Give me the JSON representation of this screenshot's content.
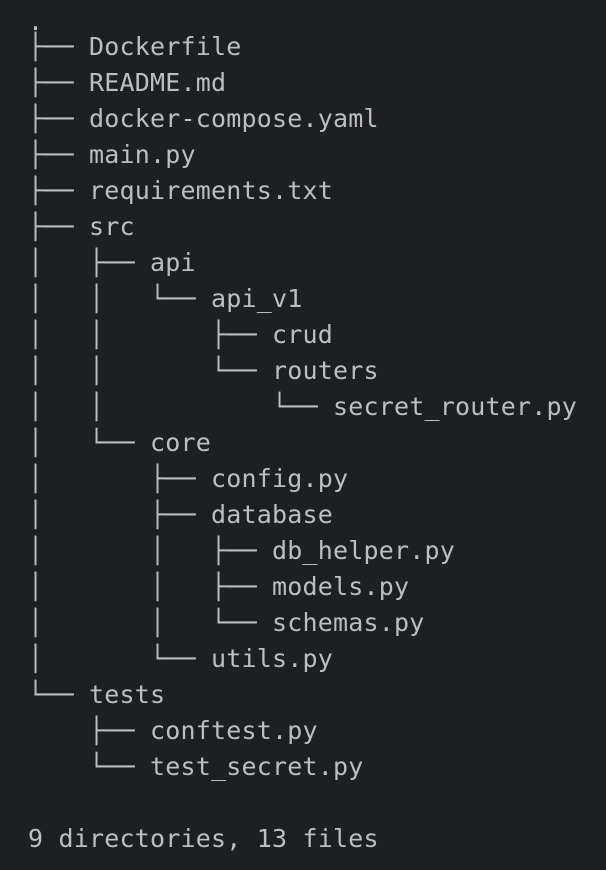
{
  "tree": {
    "root": ".",
    "lines": [
      {
        "prefix": "├── ",
        "name": "Dockerfile"
      },
      {
        "prefix": "├── ",
        "name": "README.md"
      },
      {
        "prefix": "├── ",
        "name": "docker-compose.yaml"
      },
      {
        "prefix": "├── ",
        "name": "main.py"
      },
      {
        "prefix": "├── ",
        "name": "requirements.txt"
      },
      {
        "prefix": "├── ",
        "name": "src"
      },
      {
        "prefix": "│   ├── ",
        "name": "api"
      },
      {
        "prefix": "│   │   └── ",
        "name": "api_v1"
      },
      {
        "prefix": "│   │       ├── ",
        "name": "crud"
      },
      {
        "prefix": "│   │       └── ",
        "name": "routers"
      },
      {
        "prefix": "│   │           └── ",
        "name": "secret_router.py"
      },
      {
        "prefix": "│   └── ",
        "name": "core"
      },
      {
        "prefix": "│       ├── ",
        "name": "config.py"
      },
      {
        "prefix": "│       ├── ",
        "name": "database"
      },
      {
        "prefix": "│       │   ├── ",
        "name": "db_helper.py"
      },
      {
        "prefix": "│       │   ├── ",
        "name": "models.py"
      },
      {
        "prefix": "│       │   └── ",
        "name": "schemas.py"
      },
      {
        "prefix": "│       └── ",
        "name": "utils.py"
      },
      {
        "prefix": "└── ",
        "name": "tests"
      },
      {
        "prefix": "    ├── ",
        "name": "conftest.py"
      },
      {
        "prefix": "    └── ",
        "name": "test_secret.py"
      }
    ]
  },
  "summary": "9 directories, 13 files",
  "colors": {
    "background": "#1e1f22",
    "text": "#bcbec4"
  }
}
